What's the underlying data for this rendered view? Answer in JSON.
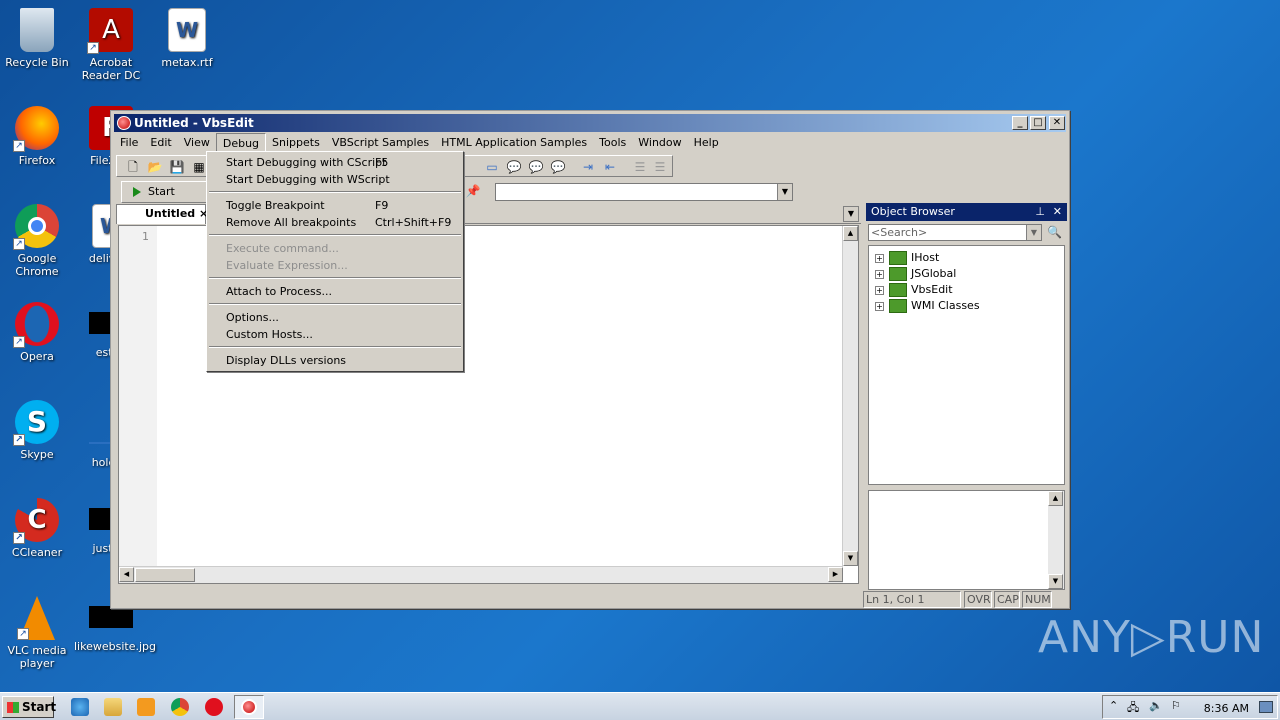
{
  "desktop": {
    "icons": [
      {
        "label": "Recycle Bin"
      },
      {
        "label": "Acrobat Reader DC"
      },
      {
        "label": "metax.rtf"
      },
      {
        "label": "Firefox"
      },
      {
        "label": "FileZilla"
      },
      {
        "label": "Google Chrome"
      },
      {
        "label": "delivery"
      },
      {
        "label": "Opera"
      },
      {
        "label": "estno"
      },
      {
        "label": "Skype"
      },
      {
        "label": "holdfro"
      },
      {
        "label": "CCleaner"
      },
      {
        "label": "justuni"
      },
      {
        "label": "VLC media player"
      },
      {
        "label": "likewebsite.jpg"
      }
    ],
    "watermark": "ANY▷RUN"
  },
  "window": {
    "title": "Untitled - VbsEdit",
    "menus": [
      "File",
      "Edit",
      "View",
      "Debug",
      "Snippets",
      "VBScript Samples",
      "HTML Application Samples",
      "Tools",
      "Window",
      "Help"
    ],
    "start_debug_label": "Start Debug",
    "tab_label": "Untitled",
    "line_number": "1",
    "status": {
      "position": "Ln 1, Col 1",
      "ovr": "OVR",
      "cap": "CAP",
      "num": "NUM"
    }
  },
  "debug_menu": {
    "items": [
      {
        "label": "Start Debugging with CScript",
        "shortcut": "F5"
      },
      {
        "label": "Start Debugging with WScript",
        "shortcut": ""
      },
      {
        "label": "Toggle Breakpoint",
        "shortcut": "F9"
      },
      {
        "label": "Remove All breakpoints",
        "shortcut": "Ctrl+Shift+F9"
      },
      {
        "label": "Execute command...",
        "shortcut": ""
      },
      {
        "label": "Evaluate Expression...",
        "shortcut": ""
      },
      {
        "label": "Attach to Process...",
        "shortcut": ""
      },
      {
        "label": "Options...",
        "shortcut": ""
      },
      {
        "label": "Custom Hosts...",
        "shortcut": ""
      },
      {
        "label": "Display DLLs versions",
        "shortcut": ""
      }
    ]
  },
  "object_browser": {
    "title": "Object Browser",
    "search_placeholder": "<Search>",
    "tree": [
      "IHost",
      "JSGlobal",
      "VbsEdit",
      "WMI Classes"
    ]
  },
  "taskbar": {
    "start_label": "Start",
    "clock": "8:36 AM"
  },
  "colors": {
    "titlebar": "#0a246a",
    "desktop": "#1a6fc2",
    "chrome_bg": "#d4d0c8"
  }
}
